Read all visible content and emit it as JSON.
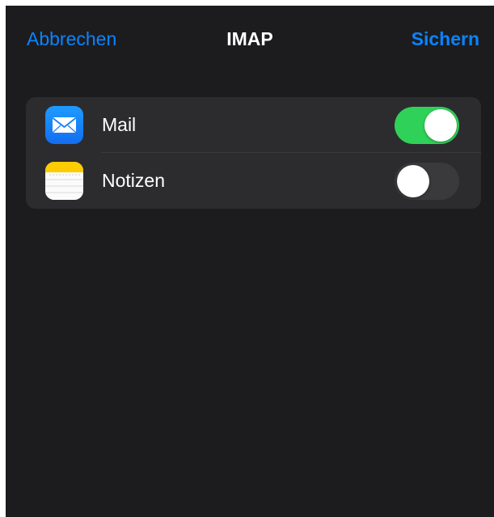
{
  "navbar": {
    "cancel_label": "Abbrechen",
    "title": "IMAP",
    "save_label": "Sichern"
  },
  "settings": {
    "items": [
      {
        "label": "Mail",
        "icon": "mail-app-icon",
        "enabled": true
      },
      {
        "label": "Notizen",
        "icon": "notes-app-icon",
        "enabled": false
      }
    ]
  },
  "colors": {
    "accent": "#0a84ff",
    "background": "#1c1c1e",
    "group_background": "#2c2c2e",
    "toggle_on": "#30d158",
    "toggle_off": "#3a3a3c"
  }
}
